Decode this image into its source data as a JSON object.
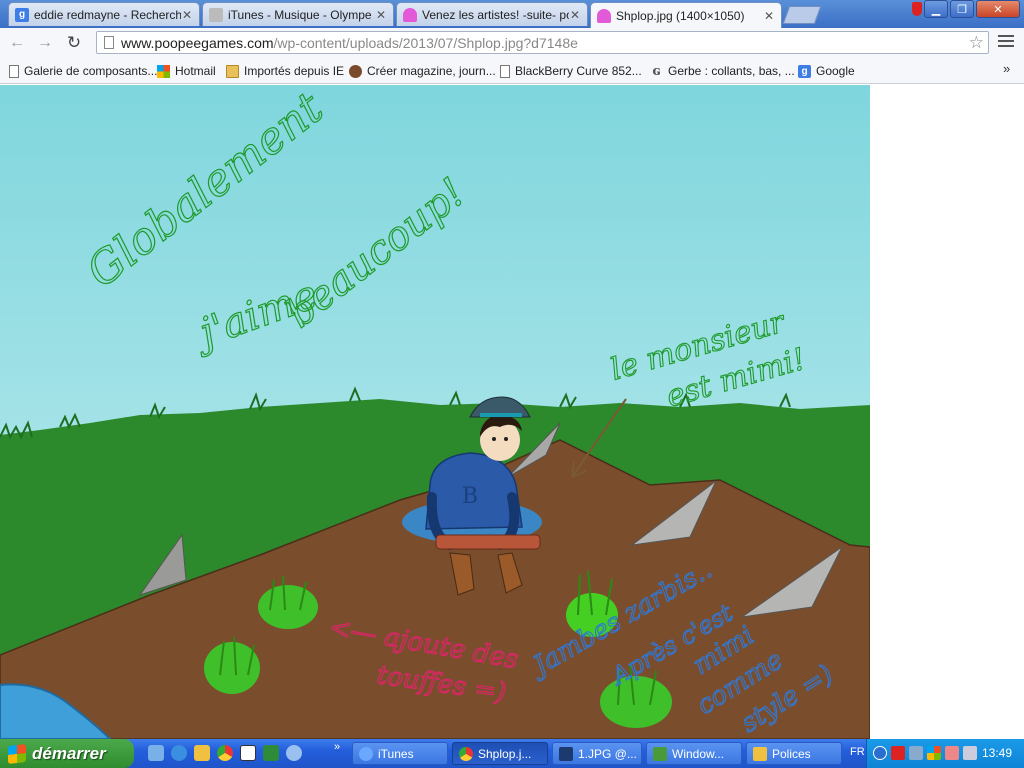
{
  "browser": {
    "tabs": [
      {
        "title": "eddie redmayne - Recherche",
        "favicon": "google-g-icon",
        "active": false
      },
      {
        "title": "iTunes - Musique - Olympe",
        "favicon": "apple-icon",
        "active": false
      },
      {
        "title": "Venez les artistes! -suite- po",
        "favicon": "pink-cake-icon",
        "active": false
      },
      {
        "title": "Shplop.jpg (1400×1050)",
        "favicon": "pink-cake-icon",
        "active": true
      }
    ],
    "url_host": "www.poopeegames.com",
    "url_path": "/wp-content/uploads/2013/07/Shplop.jpg?d7148e",
    "bookmarks": [
      {
        "label": "Galerie de composants...",
        "icon": "page-icon"
      },
      {
        "label": "Hotmail",
        "icon": "microsoft-icon"
      },
      {
        "label": "Importés depuis IE",
        "icon": "folder-icon"
      },
      {
        "label": "Créer magazine, journ...",
        "icon": "magazine-icon"
      },
      {
        "label": "BlackBerry Curve 852...",
        "icon": "page-icon"
      },
      {
        "label": "Gerbe : collants, bas, ...",
        "icon": "gerbe-icon"
      },
      {
        "label": "Google",
        "icon": "google-g-icon"
      }
    ]
  },
  "image": {
    "texts": {
      "globalement": "Globalement",
      "jaime": "j'aime",
      "beaucoup": "beaucoup!",
      "le_monsieur": "le monsieur",
      "est_mimi": "est mimi!",
      "ajoute": "<— ajoute des",
      "touffes": "touffes =)",
      "jambes": "Jambes zarbis..",
      "apres": "Après c'est",
      "mimi": "mimi",
      "comme": "comme",
      "style": "style =)",
      "sweater_letter": "B"
    },
    "colors": {
      "sky": "#a6e2e8",
      "grass": "#2c8a2c",
      "ground": "#7a4e2c",
      "green_ink": "#1f9a2a",
      "pink_ink": "#e0246a",
      "blue_ink": "#2f78d8",
      "sweater": "#2a5aa8",
      "water": "#3f9fd8"
    }
  },
  "taskbar": {
    "start_label": "démarrer",
    "tasks": [
      {
        "label": "iTunes",
        "icon": "itunes-icon",
        "active": false
      },
      {
        "label": "Shplop.j...",
        "icon": "chrome-icon",
        "active": true
      },
      {
        "label": "1.JPG @...",
        "icon": "photoshop-icon",
        "active": false
      },
      {
        "label": "Window...",
        "icon": "windows-live-icon",
        "active": false
      },
      {
        "label": "Polices",
        "icon": "folder-icon",
        "active": false
      }
    ],
    "language": "FR",
    "clock": "13:49"
  }
}
